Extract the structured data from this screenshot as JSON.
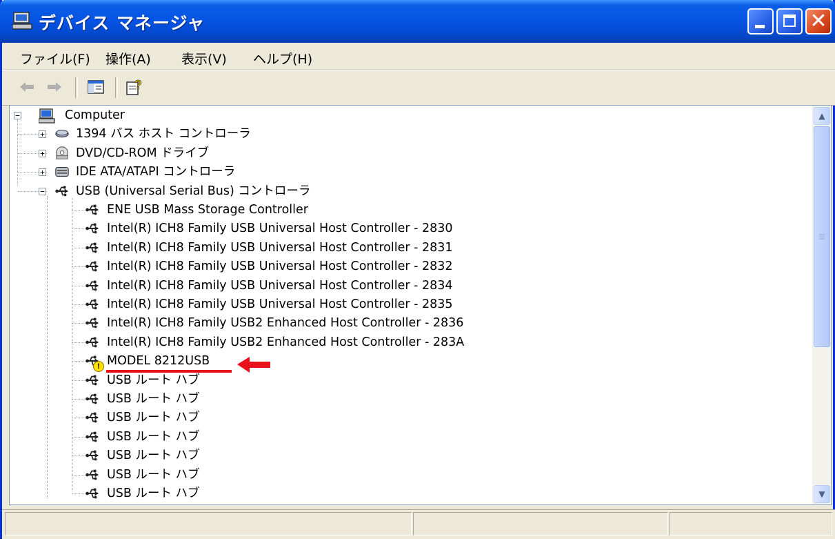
{
  "window": {
    "title": "デバイス マネージャ"
  },
  "menu": [
    "ファイル(F)",
    "操作(A)",
    "表示(V)",
    "ヘルプ(H)"
  ],
  "tree": {
    "root": "Computer",
    "categories": [
      {
        "label": "1394 バス ホスト コントローラ",
        "icon": "firewire-icon",
        "expanded": false
      },
      {
        "label": "DVD/CD-ROM ドライブ",
        "icon": "disc-drive-icon",
        "expanded": false
      },
      {
        "label": "IDE ATA/ATAPI コントローラ",
        "icon": "ide-controller-icon",
        "expanded": false
      },
      {
        "label": "USB (Universal Serial Bus) コントローラ",
        "icon": "usb-icon",
        "expanded": true
      }
    ],
    "usb_children": [
      {
        "label": "ENE USB Mass Storage Controller",
        "warning": false
      },
      {
        "label": "Intel(R) ICH8 Family USB Universal Host Controller - 2830",
        "warning": false
      },
      {
        "label": "Intel(R) ICH8 Family USB Universal Host Controller - 2831",
        "warning": false
      },
      {
        "label": "Intel(R) ICH8 Family USB Universal Host Controller - 2832",
        "warning": false
      },
      {
        "label": "Intel(R) ICH8 Family USB Universal Host Controller - 2834",
        "warning": false
      },
      {
        "label": "Intel(R) ICH8 Family USB Universal Host Controller - 2835",
        "warning": false
      },
      {
        "label": "Intel(R) ICH8 Family USB2 Enhanced Host Controller - 2836",
        "warning": false
      },
      {
        "label": "Intel(R) ICH8 Family USB2 Enhanced Host Controller - 283A",
        "warning": false
      },
      {
        "label": "MODEL 8212USB",
        "warning": true,
        "highlighted": true
      },
      {
        "label": "USB ルート ハブ",
        "warning": false
      },
      {
        "label": "USB ルート ハブ",
        "warning": false
      },
      {
        "label": "USB ルート ハブ",
        "warning": false
      },
      {
        "label": "USB ルート ハブ",
        "warning": false
      },
      {
        "label": "USB ルート ハブ",
        "warning": false
      },
      {
        "label": "USB ルート ハブ",
        "warning": false
      },
      {
        "label": "USB ルート ハブ",
        "warning": false
      }
    ]
  },
  "colors": {
    "titlebar": "#0553e4",
    "annotation": "#e8101a",
    "warning": "#ffe000"
  }
}
